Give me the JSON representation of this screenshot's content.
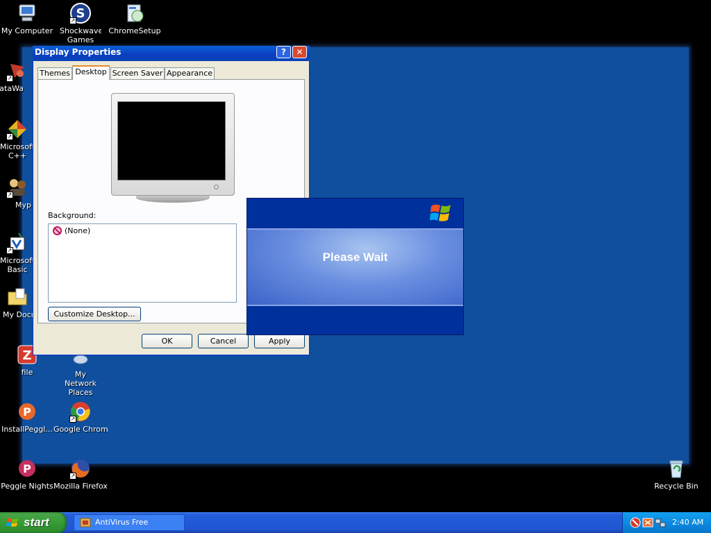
{
  "desktop": {
    "icons": [
      {
        "label": "My Computer"
      },
      {
        "label": "Shockwave Games"
      },
      {
        "label": "ChromeSetup"
      },
      {
        "label": "DataWa"
      },
      {
        "label": "Microsoft C++"
      },
      {
        "label": "Myp"
      },
      {
        "label": "Microsoft Basic"
      },
      {
        "label": "My Docu"
      },
      {
        "label": "file"
      },
      {
        "label": "My Network Places"
      },
      {
        "label": "InstallPeggl..."
      },
      {
        "label": "Google Chrome"
      },
      {
        "label": "Peggle Nights"
      },
      {
        "label": "Mozilla Firefox"
      },
      {
        "label": "Recycle Bin"
      }
    ]
  },
  "display_properties": {
    "title": "Display Properties",
    "help_glyph": "?",
    "close_glyph": "✕",
    "tabs": [
      {
        "label": "Themes"
      },
      {
        "label": "Desktop"
      },
      {
        "label": "Screen Saver"
      },
      {
        "label": "Appearance"
      }
    ],
    "active_tab": "Desktop",
    "background_label": "Background:",
    "background_items": [
      {
        "label": "(None)"
      }
    ],
    "customize_label": "Customize Desktop...",
    "ok_label": "OK",
    "cancel_label": "Cancel",
    "apply_label": "Apply"
  },
  "wait_dialog": {
    "message": "Please Wait"
  },
  "taskbar": {
    "start_label": "start",
    "task_items": [
      {
        "label": "AntiVirus Free"
      }
    ],
    "clock": "2:40 AM"
  },
  "colors": {
    "wallpaper": "#0f4f9e",
    "taskbar": "#245edb",
    "start_button": "#369c36",
    "tray": "#0c8ae0",
    "title_bar": "#0a5fd8",
    "close_button": "#d8492f"
  }
}
